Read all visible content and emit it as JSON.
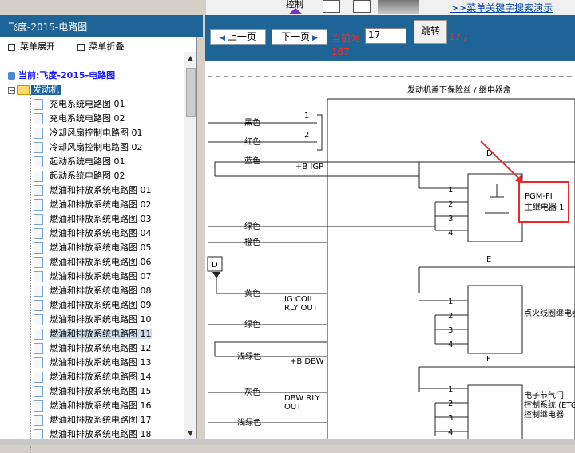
{
  "topbar": {
    "control_label": "控制",
    "help_link": ">>菜单关键字搜索演示"
  },
  "left": {
    "title": "飞度-2015-电路图",
    "menu_expand": "菜单展开",
    "menu_collapse": "菜单折叠",
    "current_prefix": "当前:",
    "current_value": "飞度-2015-电路图",
    "node_toggle": "−",
    "node_label": "发动机",
    "items": [
      "充电系统电路图 01",
      "充电系统电路图 02",
      "冷却风扇控制电路图 01",
      "冷却风扇控制电路图 02",
      "起动系统电路图 01",
      "起动系统电路图 02",
      "燃油和排放系统电路图 01",
      "燃油和排放系统电路图 02",
      "燃油和排放系统电路图 03",
      "燃油和排放系统电路图 04",
      "燃油和排放系统电路图 05",
      "燃油和排放系统电路图 06",
      "燃油和排放系统电路图 07",
      "燃油和排放系统电路图 08",
      "燃油和排放系统电路图 09",
      "燃油和排放系统电路图 10",
      "燃油和排放系统电路图 11",
      "燃油和排放系统电路图 12",
      "燃油和排放系统电路图 13",
      "燃油和排放系统电路图 14",
      "燃油和排放系统电路图 15",
      "燃油和排放系统电路图 16",
      "燃油和排放系统电路图 17",
      "燃油和排放系统电路图 18"
    ],
    "selected_index": 16
  },
  "nav": {
    "prev": "上一页",
    "next": "下一页",
    "current_label": "当前为",
    "page_value": "17",
    "jump": "跳转",
    "page_of": "17 /",
    "total": "167"
  },
  "diagram": {
    "title": "发动机盖下保险丝 / 继电器盒",
    "wires": [
      "黑色",
      "红色",
      "蓝色",
      "绿色",
      "橙色",
      "黄色",
      "绿色",
      "浅绿色",
      "灰色",
      "浅绿色"
    ],
    "pin_labels": [
      "1",
      "2",
      "1",
      "2",
      "3",
      "4",
      "1",
      "2",
      "3",
      "4",
      "1",
      "2",
      "3",
      "4"
    ],
    "fuses": [
      "D",
      "E",
      "F"
    ],
    "connector_d": "D",
    "notes": [
      "+B IGP",
      "IG COIL",
      "RLY OUT",
      "+B DBW",
      "DBW RLY",
      "OUT"
    ],
    "relay1_line1": "PGM-FI",
    "relay1_line2": "主继电器 1",
    "relay2": "点火线圈继电器",
    "relay3_line1": "电子节气门",
    "relay3_line2": "控制系统 (ETCS)",
    "relay3_line3": "控制继电器",
    "highlight_color": "#e82a2a"
  }
}
